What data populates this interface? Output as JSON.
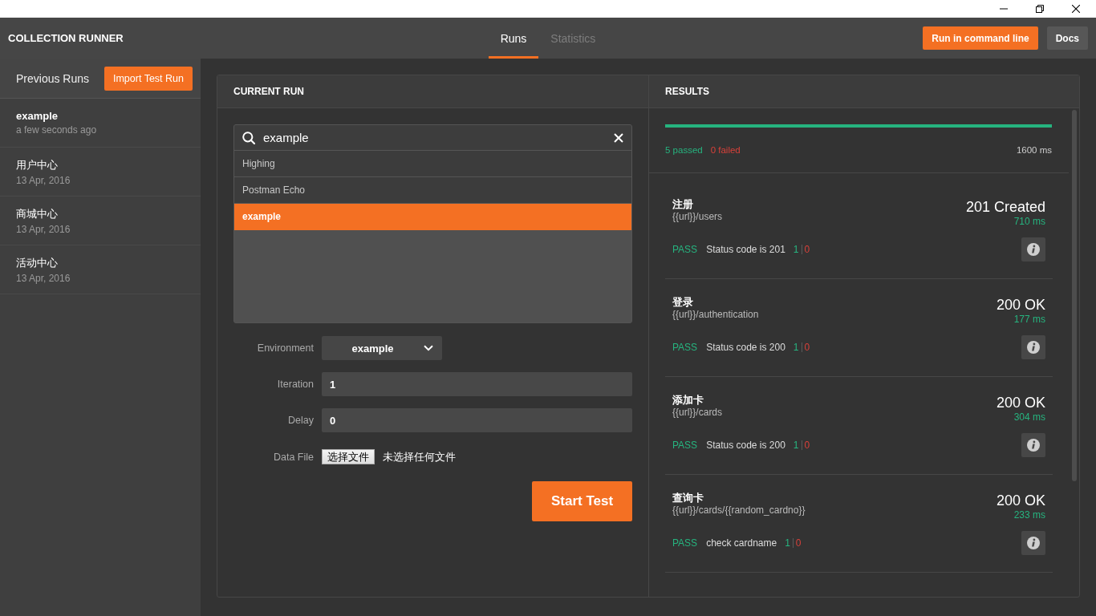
{
  "header": {
    "title": "COLLECTION RUNNER",
    "tabs": [
      {
        "label": "Runs",
        "selected": true
      },
      {
        "label": "Statistics",
        "selected": false
      }
    ],
    "actions": [
      {
        "label": "Run in command line",
        "kind": "primary"
      },
      {
        "label": "Docs",
        "kind": "secondary"
      }
    ]
  },
  "sidebar": {
    "title": "Previous Runs",
    "import_button": "Import Test Run",
    "runs": [
      {
        "name": "example",
        "time": "a few seconds ago"
      },
      {
        "name": "用户中心",
        "time": "13 Apr, 2016"
      },
      {
        "name": "商城中心",
        "time": "13 Apr, 2016"
      },
      {
        "name": "活动中心",
        "time": "13 Apr, 2016"
      }
    ]
  },
  "current_run": {
    "title": "CURRENT RUN",
    "search": {
      "value": "example"
    },
    "collections": [
      {
        "label": "Highing",
        "selected": false
      },
      {
        "label": "Postman Echo",
        "selected": false
      },
      {
        "label": "example",
        "selected": true
      }
    ],
    "environment": {
      "label": "Environment",
      "value": "example"
    },
    "iteration": {
      "label": "Iteration",
      "value": "1"
    },
    "delay": {
      "label": "Delay",
      "value": "0"
    },
    "data_file": {
      "label": "Data File",
      "button": "选择文件",
      "status": "未选择任何文件"
    },
    "start_button": "Start Test"
  },
  "results": {
    "title": "RESULTS",
    "progress": {
      "level": 1
    },
    "passed": "5 passed",
    "failed": "0 failed",
    "duration": "1600 ms",
    "requests": [
      {
        "name": "注册",
        "url": "{{url}}/users",
        "status": "201 Created",
        "time": "710 ms",
        "tests": [
          {
            "result": "PASS",
            "name": "Status code is 201",
            "pass_count": "1",
            "fail_count": "0"
          }
        ]
      },
      {
        "name": "登录",
        "url": "{{url}}/authentication",
        "status": "200 OK",
        "time": "177 ms",
        "tests": [
          {
            "result": "PASS",
            "name": "Status code is 200",
            "pass_count": "1",
            "fail_count": "0"
          }
        ]
      },
      {
        "name": "添加卡",
        "url": "{{url}}/cards",
        "status": "200 OK",
        "time": "304 ms",
        "tests": [
          {
            "result": "PASS",
            "name": "Status code is 200",
            "pass_count": "1",
            "fail_count": "0"
          }
        ]
      },
      {
        "name": "查询卡",
        "url": "{{url}}/cards/{{random_cardno}}",
        "status": "200 OK",
        "time": "233 ms",
        "tests": [
          {
            "result": "PASS",
            "name": "check cardname",
            "pass_count": "1",
            "fail_count": "0"
          }
        ]
      }
    ]
  }
}
